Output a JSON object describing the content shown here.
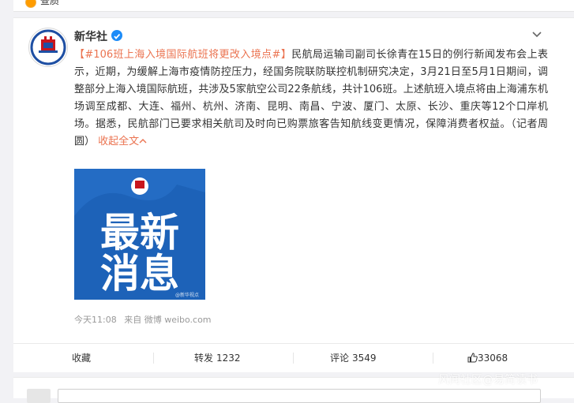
{
  "top": {
    "label": "查质"
  },
  "post": {
    "author": "新华社",
    "hashtag": "【#106班上海入境国际航班将更改入境点#】",
    "body": "民航局运输司副司长徐青在15日的例行新闻发布会上表示，近期，为缓解上海市疫情防控压力，经国务院联防联控机制研究决定，3月21日至5月1日期间，调整部分上海入境国际航班，共涉及5家航空公司22条航线，共计106班。上述航班入境点将由上海浦东机场调至成都、大连、福州、杭州、济南、昆明、南昌、宁波、厦门、太原、长沙、重庆等12个口岸机场。据悉，民航部门已要求相关航司及时向已购票旅客告知航线变更情况，保障消费者权益。（记者周圆）",
    "collapse": "收起全文",
    "image": {
      "line1": "最新",
      "line2": "消息",
      "credit": "@新华视点"
    },
    "time": "今天11:08",
    "source": "来自 微博 weibo.com"
  },
  "actions": {
    "favorite": "收藏",
    "repost": "转发",
    "repost_count": "1232",
    "comment": "评论",
    "comment_count": "3549",
    "like_count": "33068"
  },
  "watermark": "风闻社区@易简读书",
  "colors": {
    "link": "#eb7350",
    "image_bg": "#1d62b8",
    "verified": "#1d8cf8"
  }
}
